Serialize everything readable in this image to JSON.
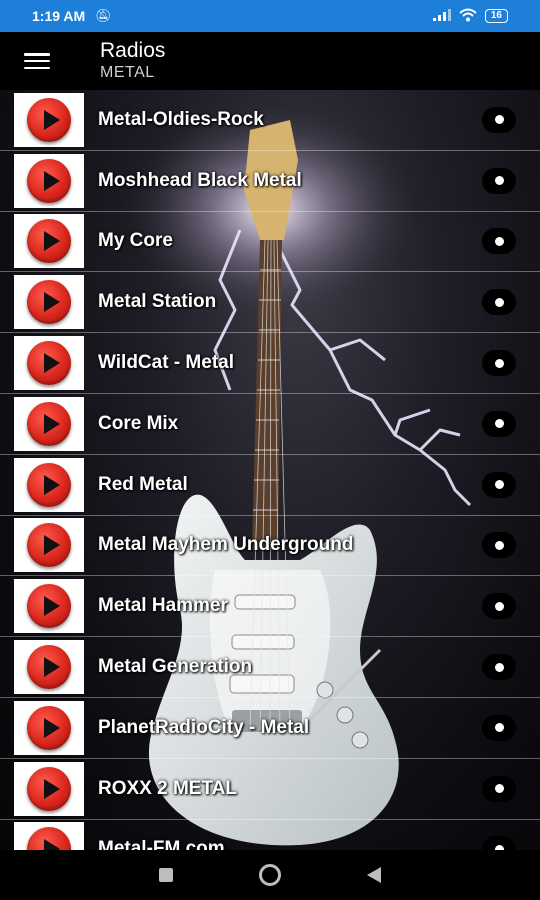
{
  "status_bar": {
    "time": "1:19 AM",
    "mute_icon": "bell-off-icon",
    "signal_icon": "signal-icon",
    "wifi_icon": "wifi-icon",
    "battery": "16"
  },
  "app_bar": {
    "title": "Radios",
    "subtitle": "METAL",
    "menu_icon": "hamburger-icon"
  },
  "stations": [
    {
      "name": "Metal-Oldies-Rock"
    },
    {
      "name": "Moshhead Black Metal"
    },
    {
      "name": "My Core"
    },
    {
      "name": "Metal Station"
    },
    {
      "name": "WildCat - Metal"
    },
    {
      "name": "Core Mix"
    },
    {
      "name": "Red Metal"
    },
    {
      "name": "Metal Mayhem Underground"
    },
    {
      "name": "Metal Hammer"
    },
    {
      "name": "Metal Generation"
    },
    {
      "name": "PlanetRadioCity - Metal"
    },
    {
      "name": "ROXX 2 METAL"
    },
    {
      "name": "Metal-FM.com"
    }
  ],
  "colors": {
    "status_bar": "#1e7fd8",
    "app_bar": "#000000",
    "play_red": "#d9261c"
  }
}
